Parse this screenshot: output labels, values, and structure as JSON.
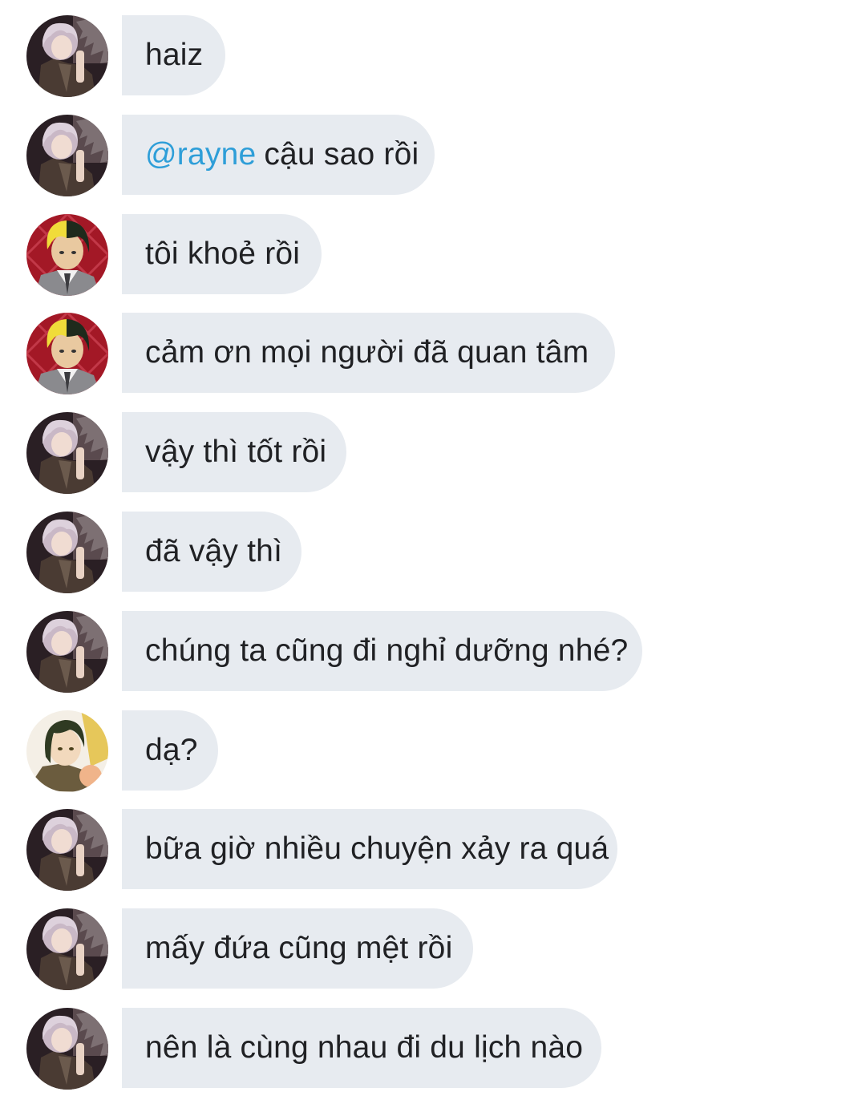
{
  "messages": [
    {
      "sender": "silver",
      "mention": "",
      "text": "haiz"
    },
    {
      "sender": "silver",
      "mention": "@rayne",
      "text": "cậu sao rồi"
    },
    {
      "sender": "rayne",
      "mention": "",
      "text": "tôi khoẻ rồi"
    },
    {
      "sender": "rayne",
      "mention": "",
      "text": "cảm ơn mọi người đã quan tâm"
    },
    {
      "sender": "silver",
      "mention": "",
      "text": "vậy thì tốt rồi"
    },
    {
      "sender": "silver",
      "mention": "",
      "text": "đã vậy thì"
    },
    {
      "sender": "silver",
      "mention": "",
      "text": "chúng ta cũng đi nghỉ dưỡng nhé?"
    },
    {
      "sender": "green",
      "mention": "",
      "text": "dạ?"
    },
    {
      "sender": "silver",
      "mention": "",
      "text": "bữa giờ nhiều chuyện xảy ra quá"
    },
    {
      "sender": "silver",
      "mention": "",
      "text": "mấy đứa cũng mệt rồi"
    },
    {
      "sender": "silver",
      "mention": "",
      "text": "nên là cùng nhau đi du lịch nào"
    }
  ],
  "colors": {
    "bubble_bg": "#e7ebf0",
    "text": "#202124",
    "mention": "#2e9ed8"
  },
  "icons": {
    "silver": "avatar-silver-hair-icon",
    "rayne": "avatar-blonde-black-hair-icon",
    "green": "avatar-green-hair-icon"
  }
}
